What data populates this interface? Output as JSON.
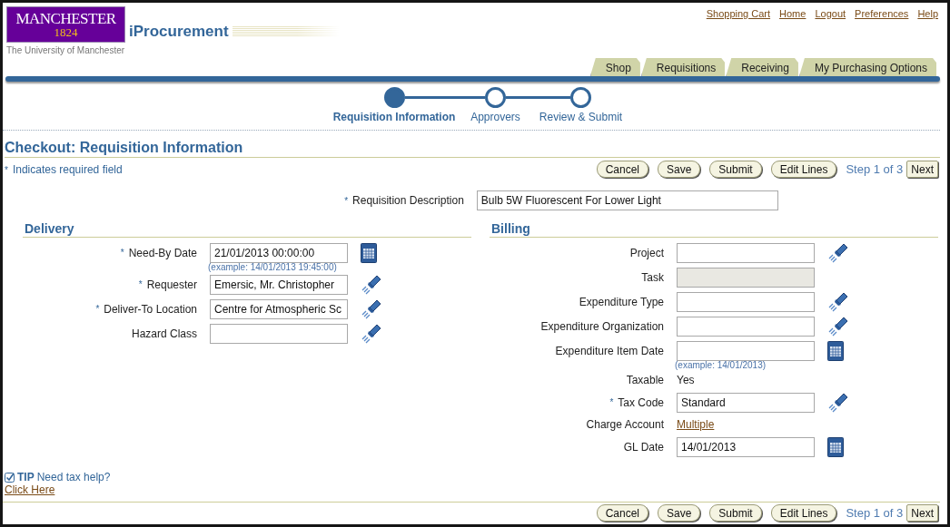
{
  "logo": {
    "name": "MANCHESTER",
    "year": "1824",
    "subtitle": "The University of Manchester"
  },
  "app_title": "iProcurement",
  "global_links": [
    "Shopping Cart",
    "Home",
    "Logout",
    "Preferences",
    "Help"
  ],
  "tabs": [
    {
      "label": "Shop",
      "selected": false
    },
    {
      "label": "Requisitions",
      "selected": false
    },
    {
      "label": "Receiving",
      "selected": false
    },
    {
      "label": "My Purchasing Options",
      "selected": false
    }
  ],
  "train": [
    {
      "label": "Requisition Information",
      "selected": true
    },
    {
      "label": "Approvers",
      "selected": false
    },
    {
      "label": "Review & Submit",
      "selected": false
    }
  ],
  "page_title": "Checkout: Requisition Information",
  "required_note": {
    "marker": "*",
    "text": "Indicates required field"
  },
  "top_actions": {
    "buttons": [
      "Cancel",
      "Save",
      "Submit",
      "Edit Lines"
    ],
    "step": "Step 1 of 3",
    "next": "Next"
  },
  "description": {
    "label": "Requisition Description",
    "required": true,
    "value": "Bulb 5W Fluorescent For Lower Light"
  },
  "delivery": {
    "title": "Delivery",
    "fields": [
      {
        "label": "Need-By Date",
        "required": true,
        "kind": "input",
        "disabled": false,
        "value": "21/01/2013 00:00:00",
        "action": {
          "kind": "calendar"
        },
        "hint": "(example: 14/01/2013 19:45:00)"
      },
      {
        "label": "Requester",
        "required": true,
        "kind": "input",
        "disabled": false,
        "value": "Emersic, Mr. Christopher",
        "action": {
          "kind": "search"
        }
      },
      {
        "label": "Deliver-To Location",
        "required": true,
        "kind": "input",
        "disabled": false,
        "value": "Centre for Atmospheric Sc",
        "action": {
          "kind": "search"
        }
      },
      {
        "label": "Hazard Class",
        "required": false,
        "kind": "input",
        "disabled": false,
        "action": {
          "kind": "search"
        }
      }
    ]
  },
  "billing": {
    "title": "Billing",
    "fields": [
      {
        "label": "Project",
        "required": false,
        "kind": "input",
        "disabled": false,
        "action": {
          "kind": "search"
        }
      },
      {
        "label": "Task",
        "required": false,
        "kind": "input",
        "disabled": true
      },
      {
        "label": "Expenditure Type",
        "required": false,
        "kind": "input",
        "disabled": false,
        "action": {
          "kind": "search"
        }
      },
      {
        "label": "Expenditure Organization",
        "required": false,
        "kind": "input",
        "disabled": false,
        "action": {
          "kind": "search"
        }
      },
      {
        "label": "Expenditure Item Date",
        "required": false,
        "kind": "input",
        "disabled": false,
        "action": {
          "kind": "calendar"
        },
        "hint": "(example: 14/01/2013)"
      },
      {
        "label": "Taxable",
        "required": false,
        "kind": "text",
        "value": "Yes"
      },
      {
        "label": "Tax Code",
        "required": true,
        "kind": "input",
        "disabled": false,
        "value": "Standard",
        "action": {
          "kind": "search"
        }
      },
      {
        "label": "Charge Account",
        "required": false,
        "kind": "link",
        "value": "Multiple"
      },
      {
        "label": "GL Date",
        "required": false,
        "kind": "input",
        "disabled": false,
        "value": "14/01/2013",
        "action": {
          "kind": "calendar"
        }
      }
    ]
  },
  "tip": {
    "label": "TIP",
    "text": "Need tax help?",
    "link": "Click Here"
  },
  "bottom_actions": {
    "buttons": [
      "Cancel",
      "Save",
      "Submit",
      "Edit Lines"
    ],
    "step": "Step 1 of 3",
    "next": "Next"
  }
}
